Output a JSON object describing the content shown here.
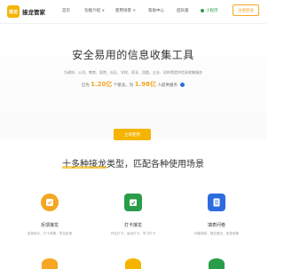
{
  "header": {
    "logo_mark": "接龙",
    "logo_text": "接龙管家",
    "nav": [
      "首页",
      "功能介绍",
      "使用场景",
      "帮助中心",
      "团队版"
    ],
    "mini_program": "小程序",
    "login": "注册登录"
  },
  "hero": {
    "title": "安全易用的信息收集工具",
    "subtitle": "为政府、公司、教育、医院、社区、学校、家长、团委、企业、机构等提供信息收集服务",
    "stats_prefix": "已为",
    "stats_value_1": "1.20亿",
    "stats_mid": "个接龙，为",
    "stats_value_2": "1.98亿",
    "stats_suffix": "人提供服务",
    "cta": "立即使用"
  },
  "section": {
    "title_highlight": "十多种接龙",
    "title_rest": "类型，匹配各种使用场景"
  },
  "cards": [
    {
      "title": "反馈接龙",
      "desc": "信息统计，打卡收集，意见反馈"
    },
    {
      "title": "打卡接龙",
      "desc": "作业打卡，运动打卡，学习打卡"
    },
    {
      "title": "填表问卷",
      "desc": "问卷调查，报名登记，信息收集"
    }
  ],
  "colors": {
    "brand": "#f5b400",
    "accent": "#f5a623",
    "green": "#2a9d4a",
    "blue": "#2d6cdf"
  }
}
